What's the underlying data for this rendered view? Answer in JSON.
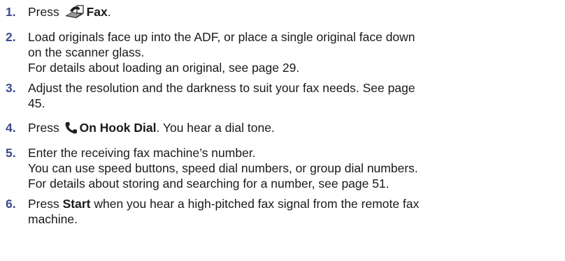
{
  "steps": [
    {
      "number": "1.",
      "prefix": "Press ",
      "icon": "fax-icon",
      "bold": "Fax",
      "suffix": "."
    },
    {
      "number": "2.",
      "line1": "Load originals face up into the ADF, or place a single original face down",
      "line2": "on the scanner glass.",
      "line3": "For details about loading an original, see page 29."
    },
    {
      "number": "3.",
      "line1": "Adjust the resolution and the darkness to suit your fax needs. See page",
      "line2": "45."
    },
    {
      "number": "4.",
      "prefix": "Press ",
      "icon": "phone-handset-icon",
      "bold": "On Hook Dial",
      "suffix": ". You hear a dial tone."
    },
    {
      "number": "5.",
      "line1": "Enter the receiving fax machine’s number.",
      "line2": "You can use speed buttons, speed dial numbers, or group dial numbers.",
      "line3": "For details about storing and searching for a number, see page 51."
    },
    {
      "number": "6.",
      "prefix": "Press ",
      "bold": "Start",
      "line1": " when you hear a high-pitched fax signal from the remote fax",
      "line2": "machine."
    }
  ]
}
